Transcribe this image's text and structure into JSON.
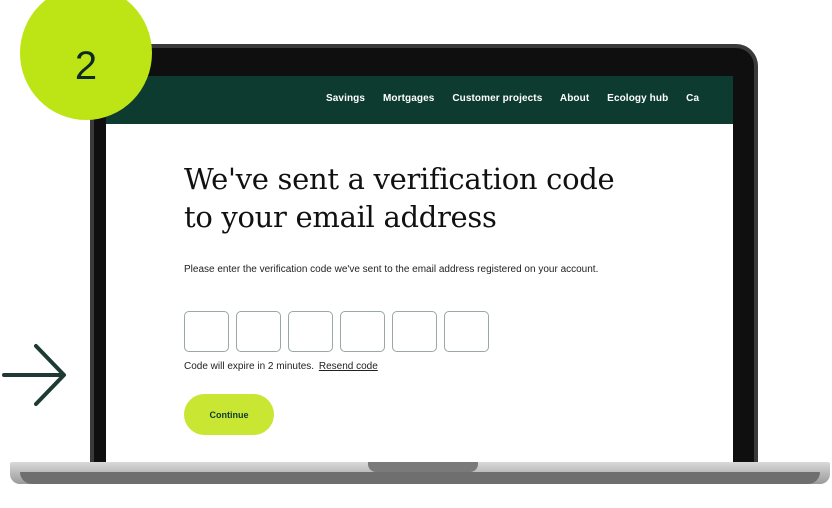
{
  "badge": {
    "step_number": "2"
  },
  "nav": {
    "items": [
      "Savings",
      "Mortgages",
      "Customer projects",
      "About",
      "Ecology hub",
      "Ca"
    ]
  },
  "page": {
    "title_line1": "We've sent a verification code",
    "title_line2": "to your email address",
    "description": "Please enter the verification code we've sent to the email address registered on your account.",
    "code_box_count": 6,
    "expiry_text": "Code will expire in 2 minutes.",
    "resend_label": "Resend code",
    "continue_label": "Continue"
  },
  "colors": {
    "badge": "#bde516",
    "nav_background": "#0d3b2f",
    "button": "#c8e632"
  },
  "icons": [
    "right-arrow-icon"
  ]
}
